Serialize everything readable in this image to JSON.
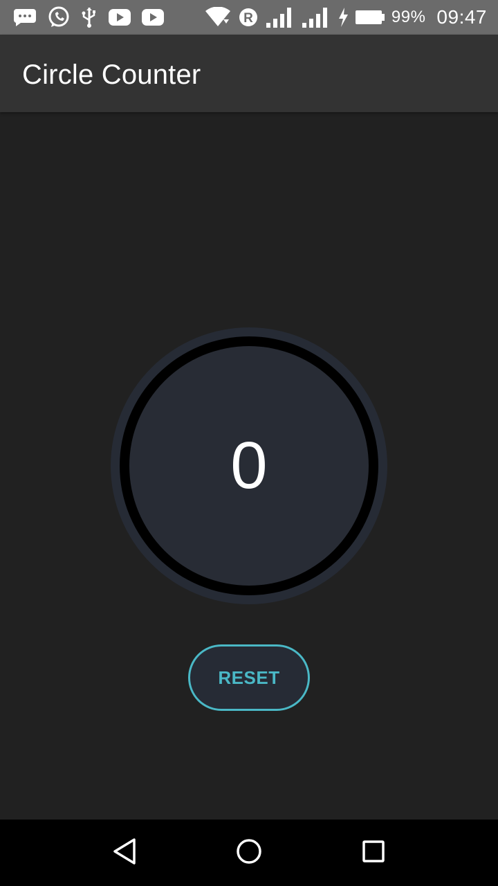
{
  "status_bar": {
    "battery_percent": "99%",
    "time": "09:47",
    "icons": [
      "chat-icon",
      "whatsapp-icon",
      "usb-icon",
      "youtube-icon",
      "youtube-icon",
      "wifi-icon",
      "roaming-r-icon",
      "signal-icon",
      "signal-icon",
      "charging-icon",
      "battery-icon"
    ]
  },
  "app_bar": {
    "title": "Circle Counter"
  },
  "counter": {
    "value": "0"
  },
  "reset_button": {
    "label": "RESET"
  },
  "nav_bar": {
    "icons": [
      "back-icon",
      "home-icon",
      "recents-icon"
    ]
  },
  "colors": {
    "background": "#212121",
    "app_bar": "#333333",
    "accent": "#4ab8c6",
    "circle_fill": "#282c35",
    "ring": "#000000"
  }
}
